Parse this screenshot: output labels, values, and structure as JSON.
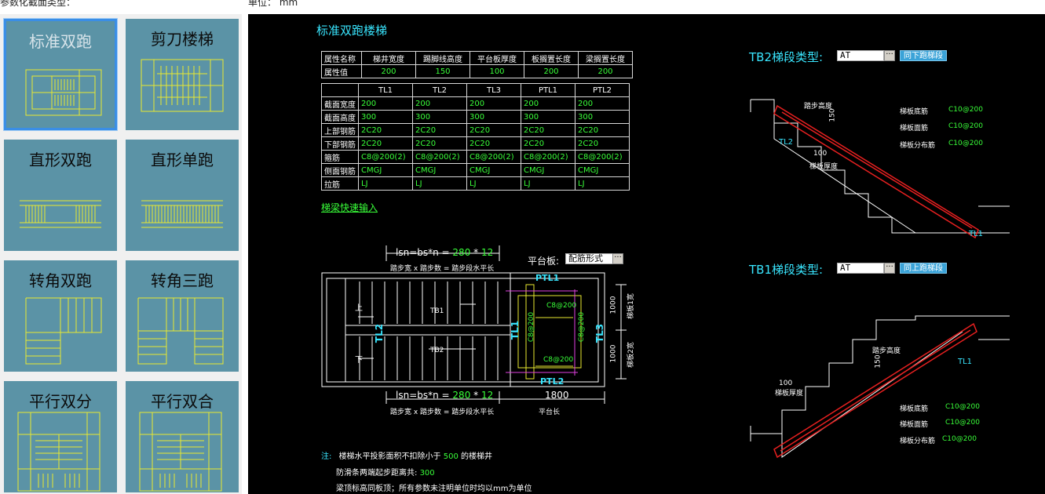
{
  "top": {
    "section_label": "参数化截面类型：",
    "unit_label": "单位： mm"
  },
  "tiles": [
    {
      "label": "标准双跑"
    },
    {
      "label": "剪刀楼梯"
    },
    {
      "label": "直形双跑"
    },
    {
      "label": "直形单跑"
    },
    {
      "label": "转角双跑"
    },
    {
      "label": "转角三跑"
    },
    {
      "label": "平行双分"
    },
    {
      "label": "平行双合"
    }
  ],
  "cad": {
    "title": "标准双跑楼梯",
    "table1": {
      "headers": [
        "属性名称",
        "梯井宽度",
        "踢脚线高度",
        "平台板厚度",
        "板搁置长度",
        "梁搁置长度"
      ],
      "row": [
        "属性值",
        "200",
        "150",
        "100",
        "200",
        "200"
      ]
    },
    "table2": {
      "headers": [
        "",
        "TL1",
        "TL2",
        "TL3",
        "PTL1",
        "PTL2"
      ],
      "rows": [
        [
          "截面宽度",
          "200",
          "200",
          "200",
          "200",
          "200"
        ],
        [
          "截面高度",
          "300",
          "300",
          "300",
          "300",
          "300"
        ],
        [
          "上部钢筋",
          "2C20",
          "2C20",
          "2C20",
          "2C20",
          "2C20"
        ],
        [
          "下部钢筋",
          "2C20",
          "2C20",
          "2C20",
          "2C20",
          "2C20"
        ],
        [
          "箍筋",
          "C8@200(2)",
          "C8@200(2)",
          "C8@200(2)",
          "C8@200(2)",
          "C8@200(2)"
        ],
        [
          "侧面钢筋",
          "CMGJ",
          "CMGJ",
          "CMGJ",
          "CMGJ",
          "CMGJ"
        ],
        [
          "拉筋",
          "LJ",
          "LJ",
          "LJ",
          "LJ",
          "LJ"
        ]
      ]
    },
    "quick_input": "梯梁快速输入",
    "plan": {
      "lsn_prefix": "lsn=bs*n =",
      "lsn_bs": "280",
      "lsn_star": "*",
      "lsn_n": "12",
      "lsn_desc": "踏步宽 x 踏步数 = 踏步段水平长",
      "platform_label": "平台板:",
      "platform_value": "配筋形式",
      "up": "上",
      "down": "下",
      "tb1": "TB1",
      "tb2": "TB2",
      "tl1": "TL1",
      "tl2": "TL2",
      "tl3": "TL3",
      "ptl1": "PTL1",
      "ptl2": "PTL2",
      "rebar_top": "C8@200",
      "rebar_bot": "C8@200",
      "rebar_v1": "C8@200",
      "rebar_v2": "C8@200",
      "dim_1000a": "1000",
      "dim_1000b": "1000",
      "width1": "梯板1宽",
      "width2": "梯板2宽",
      "platform_len": "1800",
      "platform_len_label": "平台长"
    },
    "notes": {
      "label": "注:",
      "line1_a": "楼梯水平投影面积不扣除小于",
      "line1_b": "500",
      "line1_c": "的楼梯井",
      "line2_a": "防滑条两端起步距离共:",
      "line2_b": "300",
      "line3": "梁顶标高同板顶；所有参数未注明单位时均以mm为单位"
    },
    "tb2": {
      "title": "TB2梯段类型:",
      "type_value": "AT",
      "button": "同下跑梯段",
      "step_height": "踏步高度",
      "dim150": "150",
      "tl2": "TL2",
      "tl1": "TL1",
      "dim100": "100",
      "thickness": "梯板厚度",
      "bottom_rebar": "梯板底筋",
      "top_rebar": "梯板面筋",
      "dist_rebar": "梯板分布筋",
      "bottom_val": "C10@200",
      "top_val": "C10@200",
      "dist_val": "C10@200"
    },
    "tb1": {
      "title": "TB1梯段类型:",
      "type_value": "AT",
      "button": "同上跑梯段",
      "step_height": "踏步高度",
      "dim150": "150",
      "tl1": "TL1",
      "dim100": "100",
      "thickness": "梯板厚度",
      "bottom_rebar": "梯板底筋",
      "top_rebar": "梯板面筋",
      "dist_rebar": "梯板分布筋",
      "bottom_val": "C10@200",
      "top_val": "C10@200",
      "dist_val": "C10@200"
    }
  }
}
